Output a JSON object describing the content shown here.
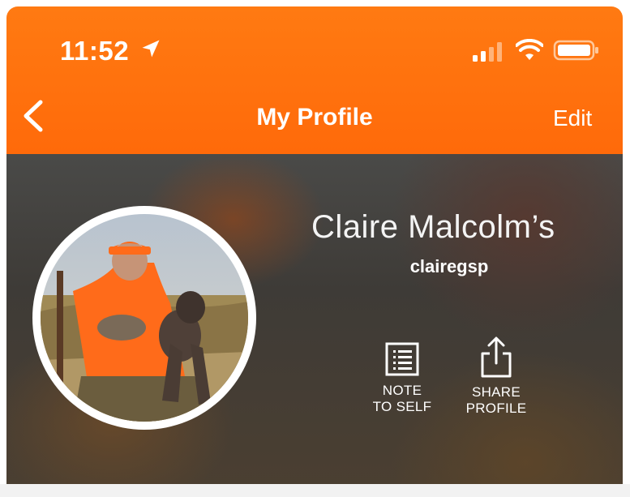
{
  "status_bar": {
    "time": "11:52",
    "icons": [
      "location-arrow-icon",
      "cellular-signal-icon",
      "wifi-icon",
      "battery-icon"
    ]
  },
  "nav": {
    "back_icon": "chevron-left-icon",
    "title": "My Profile",
    "edit_label": "Edit"
  },
  "profile": {
    "name": "Claire Malcolm’s",
    "username": "clairegsp",
    "avatar_icon": "profile-photo"
  },
  "actions": [
    {
      "icon": "note-icon",
      "line1": "NOTE",
      "line2": "TO SELF"
    },
    {
      "icon": "share-icon",
      "line1": "SHARE",
      "line2": "PROFILE"
    }
  ],
  "colors": {
    "header_orange": "#ff6f0e",
    "hero_dark": "#3e3b37",
    "text_white": "#ffffff"
  }
}
